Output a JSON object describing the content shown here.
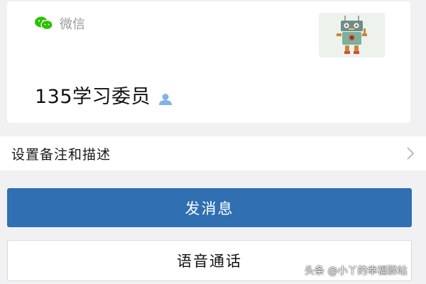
{
  "profile": {
    "app_label": "微信",
    "name": "135学习委员",
    "avatar_icon": "robot-avatar",
    "gender_icon": "person-icon"
  },
  "remarks": {
    "label": "设置备注和描述",
    "chevron_icon": "chevron-right-icon"
  },
  "actions": {
    "send_message_label": "发消息",
    "voice_call_label": "语音通话"
  },
  "watermark": {
    "text": "头条 @小丫的幸福驿站"
  },
  "colors": {
    "primary_button": "#2f6fb2",
    "wechat_green": "#2dc100",
    "person_icon_blue": "#7fb3e6",
    "background": "#f1f1f4"
  }
}
